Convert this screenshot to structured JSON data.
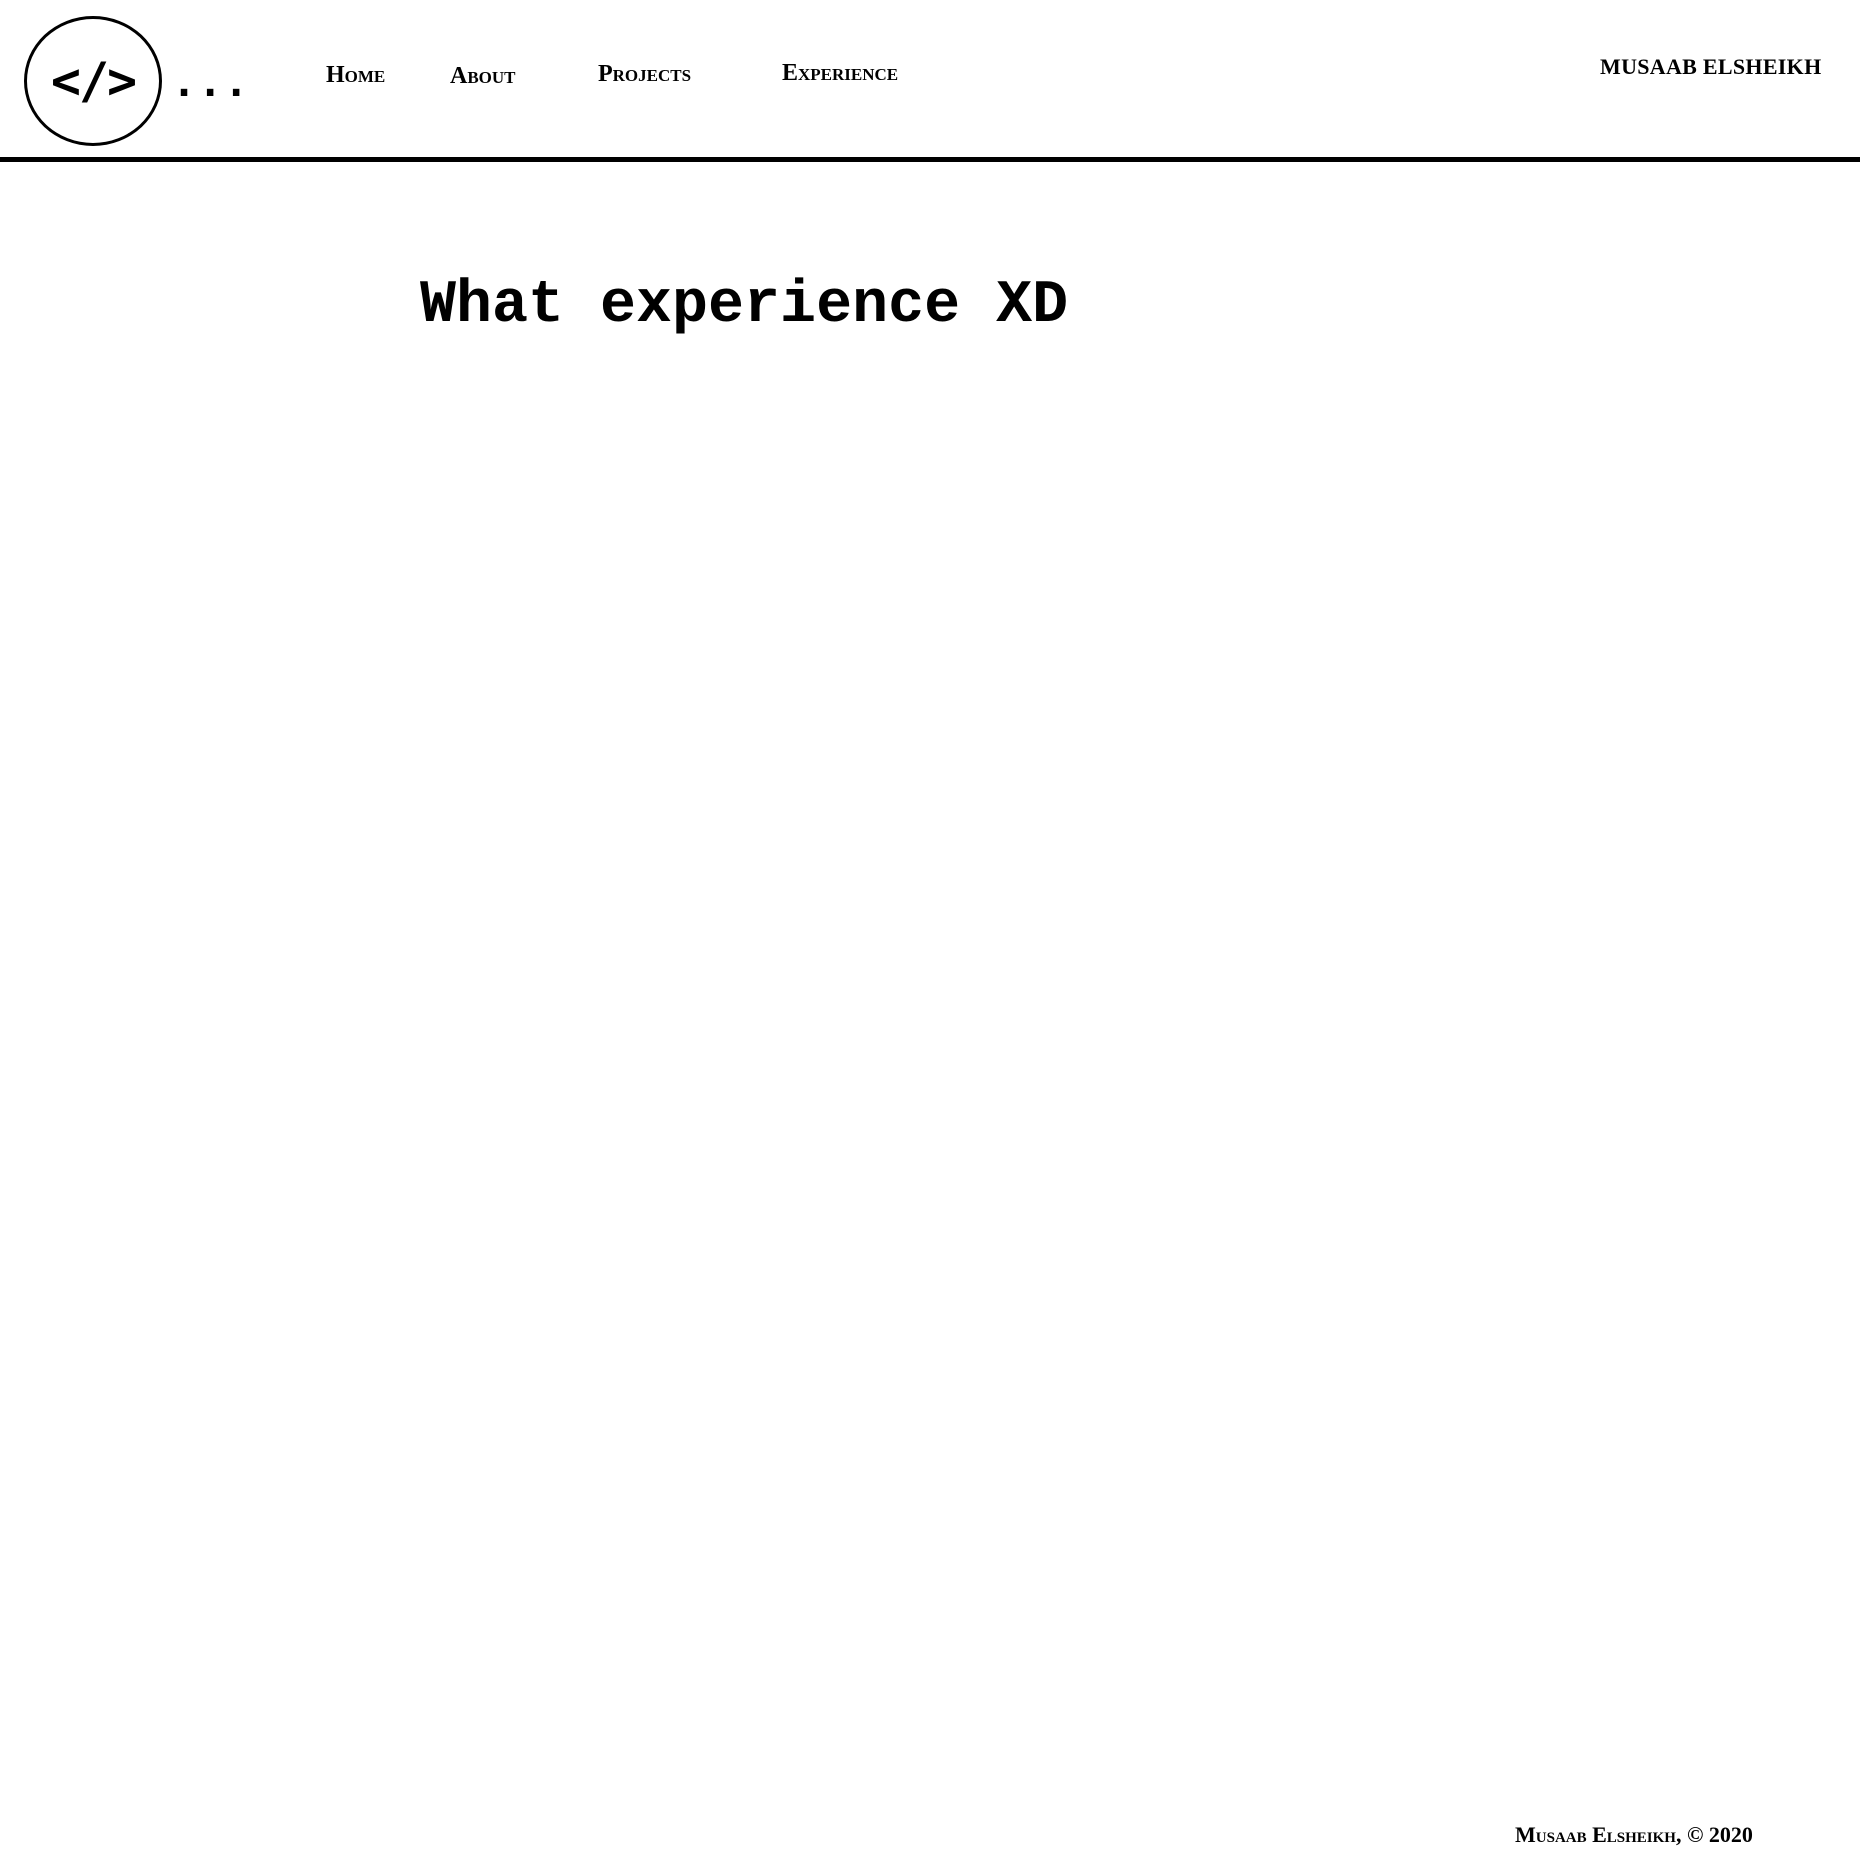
{
  "header": {
    "logo": {
      "symbol": "</>",
      "dots": "...",
      "icon": "code-brackets-icon"
    },
    "nav": [
      {
        "label": "Home"
      },
      {
        "label": "About"
      },
      {
        "label": "Projects"
      },
      {
        "label": "Experience"
      }
    ],
    "brand_name": "MUSAAB ELSHEIKH"
  },
  "main": {
    "title": "What experience XD"
  },
  "footer": {
    "text": "Musaab Elsheikh, © 2020"
  },
  "colors": {
    "background": "#ffffff",
    "text": "#000000",
    "rule": "#000000"
  }
}
